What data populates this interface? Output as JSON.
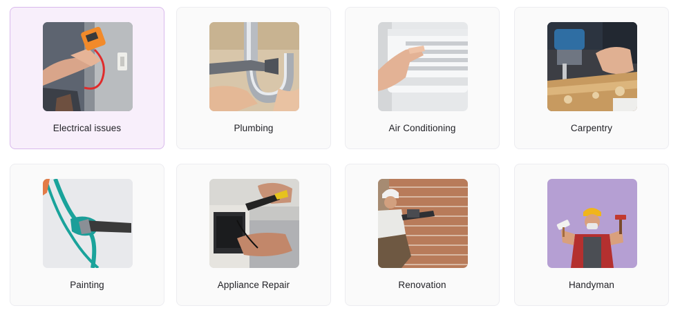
{
  "services": [
    {
      "label": "Electrical issues",
      "icon": "electrical-photo",
      "selected": true
    },
    {
      "label": "Plumbing",
      "icon": "plumbing-photo",
      "selected": false
    },
    {
      "label": "Air Conditioning",
      "icon": "air-conditioning-photo",
      "selected": false
    },
    {
      "label": "Carpentry",
      "icon": "carpentry-photo",
      "selected": false
    },
    {
      "label": "Painting",
      "icon": "painting-photo",
      "selected": false
    },
    {
      "label": "Appliance Repair",
      "icon": "appliance-repair-photo",
      "selected": false
    },
    {
      "label": "Renovation",
      "icon": "renovation-photo",
      "selected": false
    },
    {
      "label": "Handyman",
      "icon": "handyman-photo",
      "selected": false
    }
  ],
  "colors": {
    "selected_background": "#f8effb",
    "selected_border": "#d9b9ec",
    "card_background": "#fafafa",
    "card_border": "#ececf0"
  }
}
